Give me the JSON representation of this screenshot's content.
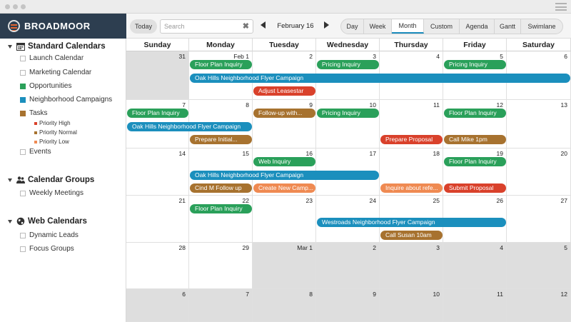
{
  "colors": {
    "green": "#2aa05a",
    "blue": "#1b8fbd",
    "brown": "#a7722f",
    "red": "#d9412b",
    "orange": "#ef8a52",
    "header": "#2d3e50",
    "accent": "#1c8dbd",
    "other_month": "#dedede"
  },
  "app": {
    "brand": "BROADMOOR"
  },
  "sidebar": {
    "groups": [
      {
        "label": "Standard Calendars",
        "icon": "calendar-icon",
        "items": [
          {
            "label": "Launch Calendar",
            "color": ""
          },
          {
            "label": "Marketing Calendar",
            "color": ""
          },
          {
            "label": "Opportunities",
            "color": "#2aa05a"
          },
          {
            "label": "Neighborhood Campaigns",
            "color": "#1b8fbd"
          },
          {
            "label": "Tasks",
            "color": "#a7722f"
          },
          {
            "label": "Events",
            "color": ""
          }
        ],
        "subitems": [
          {
            "label": "Priority High",
            "color": "#d9412b"
          },
          {
            "label": "Priority Normal",
            "color": "#a7722f"
          },
          {
            "label": "Priority Low",
            "color": "#ef8a52"
          }
        ]
      },
      {
        "label": "Calendar Groups",
        "icon": "users-icon",
        "items": [
          {
            "label": "Weekly Meetings",
            "color": ""
          }
        ]
      },
      {
        "label": "Web Calendars",
        "icon": "globe-icon",
        "items": [
          {
            "label": "Dynamic Leads",
            "color": ""
          },
          {
            "label": "Focus Groups",
            "color": ""
          }
        ]
      }
    ]
  },
  "toolbar": {
    "today_label": "Today",
    "search_placeholder": "Search",
    "search_value": "",
    "current_date": "February 16",
    "views": [
      "Day",
      "Week",
      "Month",
      "Custom",
      "Agenda",
      "Gantt",
      "Swimlane"
    ],
    "active_view": "Month"
  },
  "calendar": {
    "weekdays": [
      "Sunday",
      "Monday",
      "Tuesday",
      "Wednesday",
      "Thursday",
      "Friday",
      "Saturday"
    ],
    "weeks": [
      [
        {
          "d": "31",
          "o": true
        },
        {
          "d": "Feb 1",
          "o": false
        },
        {
          "d": "2",
          "o": false
        },
        {
          "d": "3",
          "o": false
        },
        {
          "d": "4",
          "o": false
        },
        {
          "d": "5",
          "o": false
        },
        {
          "d": "6",
          "o": false
        }
      ],
      [
        {
          "d": "7",
          "o": false
        },
        {
          "d": "8",
          "o": false
        },
        {
          "d": "9",
          "o": false
        },
        {
          "d": "10",
          "o": false
        },
        {
          "d": "11",
          "o": false
        },
        {
          "d": "12",
          "o": false
        },
        {
          "d": "13",
          "o": false
        }
      ],
      [
        {
          "d": "14",
          "o": false
        },
        {
          "d": "15",
          "o": false
        },
        {
          "d": "16",
          "o": false
        },
        {
          "d": "17",
          "o": false
        },
        {
          "d": "18",
          "o": false
        },
        {
          "d": "19",
          "o": false
        },
        {
          "d": "20",
          "o": false
        }
      ],
      [
        {
          "d": "21",
          "o": false
        },
        {
          "d": "22",
          "o": false
        },
        {
          "d": "23",
          "o": false
        },
        {
          "d": "24",
          "o": false
        },
        {
          "d": "25",
          "o": false
        },
        {
          "d": "26",
          "o": false
        },
        {
          "d": "27",
          "o": false
        }
      ],
      [
        {
          "d": "28",
          "o": false
        },
        {
          "d": "29",
          "o": false
        },
        {
          "d": "Mar 1",
          "o": true
        },
        {
          "d": "2",
          "o": true
        },
        {
          "d": "3",
          "o": true
        },
        {
          "d": "4",
          "o": true
        },
        {
          "d": "5",
          "o": true
        }
      ],
      [
        {
          "d": "6",
          "o": true
        },
        {
          "d": "7",
          "o": true
        },
        {
          "d": "8",
          "o": true
        },
        {
          "d": "9",
          "o": true
        },
        {
          "d": "10",
          "o": true
        },
        {
          "d": "11",
          "o": true
        },
        {
          "d": "12",
          "o": true
        }
      ]
    ],
    "events": [
      {
        "week": 0,
        "start": 1,
        "span": 1,
        "slot": 0,
        "title": "Floor Plan Inquiry",
        "color": "green"
      },
      {
        "week": 0,
        "start": 3,
        "span": 1,
        "slot": 0,
        "title": "Pricing Inquiry",
        "color": "green"
      },
      {
        "week": 0,
        "start": 5,
        "span": 1,
        "slot": 0,
        "title": "Pricing Inquiry",
        "color": "green"
      },
      {
        "week": 0,
        "start": 1,
        "span": 6,
        "slot": 1,
        "title": "Oak Hills Neighborhood Flyer Campaign",
        "color": "blue"
      },
      {
        "week": 0,
        "start": 2,
        "span": 1,
        "slot": 2,
        "title": "Adjust Leasestar",
        "color": "red"
      },
      {
        "week": 1,
        "start": 0,
        "span": 1,
        "slot": 0,
        "title": "Floor Plan Inquiry",
        "color": "green"
      },
      {
        "week": 1,
        "start": 2,
        "span": 1,
        "slot": 0,
        "title": "Follow-up with...",
        "color": "brown"
      },
      {
        "week": 1,
        "start": 3,
        "span": 1,
        "slot": 0,
        "title": "Pricing Inquiry",
        "color": "green"
      },
      {
        "week": 1,
        "start": 5,
        "span": 1,
        "slot": 0,
        "title": "Floor Plan Inquiry",
        "color": "green"
      },
      {
        "week": 1,
        "start": 0,
        "span": 2,
        "slot": 1,
        "title": "Oak Hills Neighborhood Flyer Campaign",
        "color": "blue"
      },
      {
        "week": 1,
        "start": 1,
        "span": 1,
        "slot": 2,
        "title": "Prepare Initial...",
        "color": "brown"
      },
      {
        "week": 1,
        "start": 4,
        "span": 1,
        "slot": 2,
        "title": "Prepare Proposal",
        "color": "red"
      },
      {
        "week": 1,
        "start": 5,
        "span": 1,
        "slot": 2,
        "title": "Call Mike 1pm",
        "color": "brown"
      },
      {
        "week": 2,
        "start": 2,
        "span": 1,
        "slot": 0,
        "title": "Web Inquiry",
        "color": "green"
      },
      {
        "week": 2,
        "start": 5,
        "span": 1,
        "slot": 0,
        "title": "Floor Plan Inquiry",
        "color": "green"
      },
      {
        "week": 2,
        "start": 1,
        "span": 3,
        "slot": 1,
        "title": "Oak Hills Neighborhood Flyer Campaign",
        "color": "blue"
      },
      {
        "week": 2,
        "start": 1,
        "span": 1,
        "slot": 2,
        "title": "Cind M Follow up",
        "color": "brown"
      },
      {
        "week": 2,
        "start": 2,
        "span": 1,
        "slot": 2,
        "title": "Create New Camp...",
        "color": "orange"
      },
      {
        "week": 2,
        "start": 4,
        "span": 1,
        "slot": 2,
        "title": "Inquire about refe...",
        "color": "orange"
      },
      {
        "week": 2,
        "start": 5,
        "span": 1,
        "slot": 2,
        "title": "Submit Proposal",
        "color": "red"
      },
      {
        "week": 3,
        "start": 1,
        "span": 1,
        "slot": 0,
        "title": "Floor Plan Inquiry",
        "color": "green"
      },
      {
        "week": 3,
        "start": 3,
        "span": 3,
        "slot": 1,
        "title": "Westroads Neighborhood Flyer Campaign",
        "color": "blue"
      },
      {
        "week": 3,
        "start": 4,
        "span": 1,
        "slot": 2,
        "title": "Call Susan 10am",
        "color": "brown"
      }
    ]
  }
}
